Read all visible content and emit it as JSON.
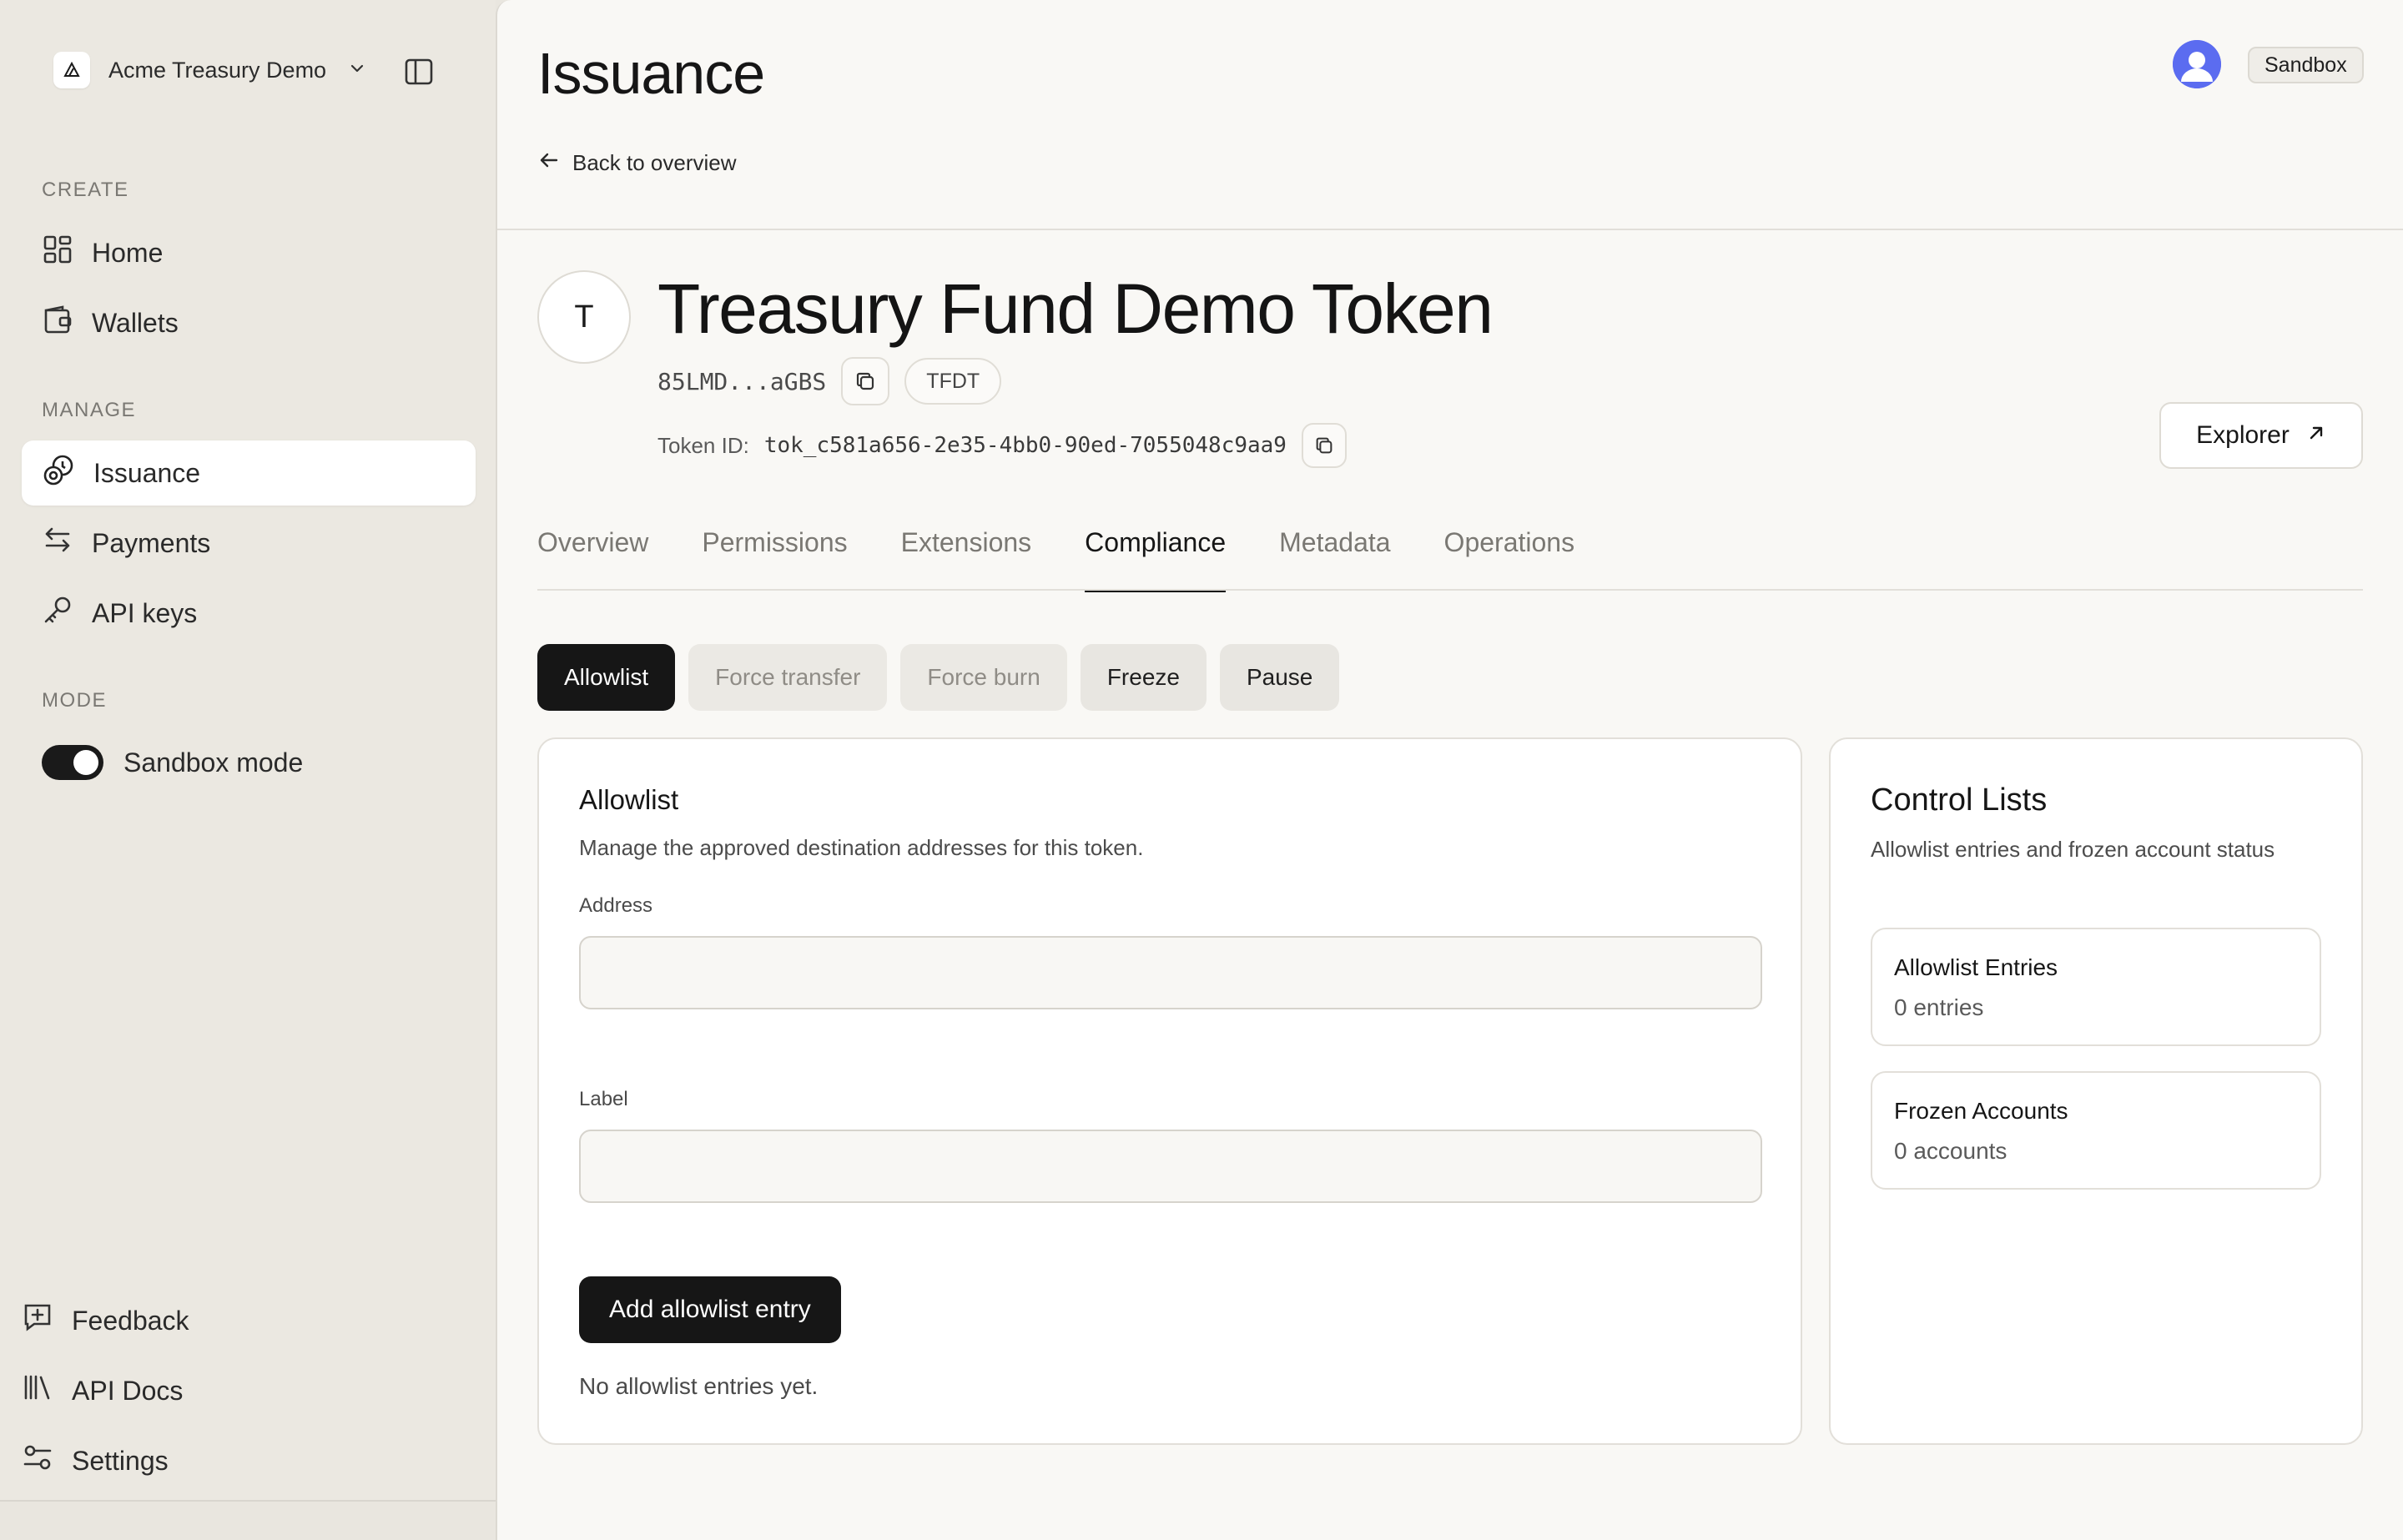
{
  "colors": {
    "sidebar_bg": "#ebe8e1",
    "main_bg": "#f9f8f5",
    "primary": "#161616",
    "avatar": "#5b6cf0"
  },
  "sidebar": {
    "org_name": "Acme Treasury Demo",
    "sections": {
      "create": "CREATE",
      "manage": "MANAGE",
      "mode": "MODE"
    },
    "items": [
      {
        "label": "Home",
        "icon": "grid-icon"
      },
      {
        "label": "Wallets",
        "icon": "wallet-icon"
      },
      {
        "label": "Issuance",
        "icon": "coins-icon",
        "active": true
      },
      {
        "label": "Payments",
        "icon": "transfer-icon"
      },
      {
        "label": "API keys",
        "icon": "key-icon"
      }
    ],
    "sandbox_toggle_label": "Sandbox mode",
    "sandbox_on": true,
    "bottom": [
      {
        "label": "Feedback",
        "icon": "feedback-icon"
      },
      {
        "label": "API Docs",
        "icon": "library-icon"
      },
      {
        "label": "Settings",
        "icon": "sliders-icon"
      }
    ]
  },
  "header": {
    "title": "Issuance",
    "back_label": "Back to overview",
    "env_badge": "Sandbox"
  },
  "token": {
    "initial": "T",
    "name": "Treasury Fund Demo Token",
    "address_short": "85LMD...aGBS",
    "ticker": "TFDT",
    "id_label": "Token ID:",
    "id_value": "tok_c581a656-2e35-4bb0-90ed-7055048c9aa9",
    "explorer_label": "Explorer"
  },
  "tabs": [
    {
      "label": "Overview"
    },
    {
      "label": "Permissions"
    },
    {
      "label": "Extensions"
    },
    {
      "label": "Compliance",
      "active": true
    },
    {
      "label": "Metadata"
    },
    {
      "label": "Operations"
    }
  ],
  "subtabs": [
    {
      "label": "Allowlist",
      "state": "active"
    },
    {
      "label": "Force transfer",
      "state": "disabled"
    },
    {
      "label": "Force burn",
      "state": "disabled"
    },
    {
      "label": "Freeze",
      "state": "enabled"
    },
    {
      "label": "Pause",
      "state": "enabled"
    }
  ],
  "allowlist": {
    "title": "Allowlist",
    "description": "Manage the approved destination addresses for this token.",
    "address_label": "Address",
    "address_value": "",
    "label_label": "Label",
    "label_value": "",
    "submit_label": "Add allowlist entry",
    "empty_text": "No allowlist entries yet."
  },
  "control_lists": {
    "title": "Control Lists",
    "description": "Allowlist entries and frozen account status",
    "items": [
      {
        "title": "Allowlist Entries",
        "value": "0 entries"
      },
      {
        "title": "Frozen Accounts",
        "value": "0 accounts"
      }
    ]
  }
}
